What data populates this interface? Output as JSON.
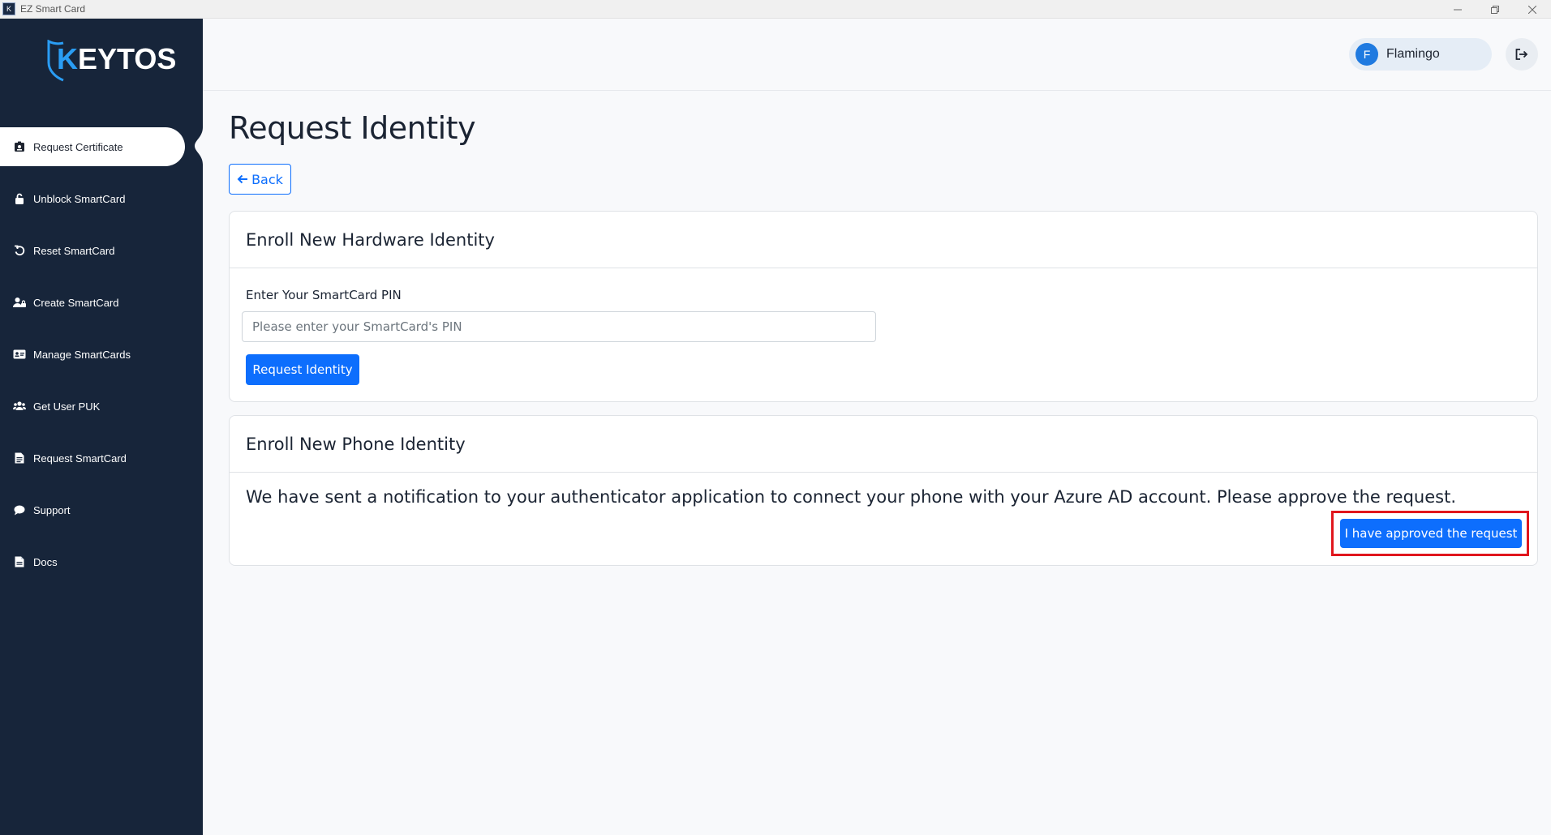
{
  "window": {
    "title": "EZ Smart Card",
    "icon_label": "K"
  },
  "sidebar": {
    "logo": {
      "first": "K",
      "rest": "EYTOS"
    },
    "items": [
      {
        "label": "Request Certificate",
        "icon": "id-badge-icon",
        "active": true
      },
      {
        "label": "Unblock SmartCard",
        "icon": "unlock-icon"
      },
      {
        "label": "Reset SmartCard",
        "icon": "undo-icon"
      },
      {
        "label": "Create SmartCard",
        "icon": "user-lock-icon"
      },
      {
        "label": "Manage SmartCards",
        "icon": "id-card-icon"
      },
      {
        "label": "Get User PUK",
        "icon": "users-icon"
      },
      {
        "label": "Request SmartCard",
        "icon": "file-icon"
      },
      {
        "label": "Support",
        "icon": "comment-icon"
      },
      {
        "label": "Docs",
        "icon": "document-icon"
      }
    ]
  },
  "header": {
    "user": {
      "initial": "F",
      "name": "Flamingo"
    },
    "logout_icon": "sign-out-icon"
  },
  "main": {
    "title": "Request Identity",
    "back_label": "Back",
    "hardware_card": {
      "title": "Enroll New Hardware Identity",
      "pin_label": "Enter Your SmartCard PIN",
      "pin_placeholder": "Please enter your SmartCard's PIN",
      "pin_value": "",
      "submit_label": "Request Identity"
    },
    "phone_card": {
      "title": "Enroll New Phone Identity",
      "message": "We have sent a notification to your authenticator application to connect your phone with your Azure AD account. Please approve the request.",
      "approve_label": "I have approved the request"
    }
  },
  "colors": {
    "sidebar_bg": "#17253a",
    "primary": "#0d6efd",
    "highlight": "#e0161d",
    "logo_accent": "#2a9df4"
  }
}
